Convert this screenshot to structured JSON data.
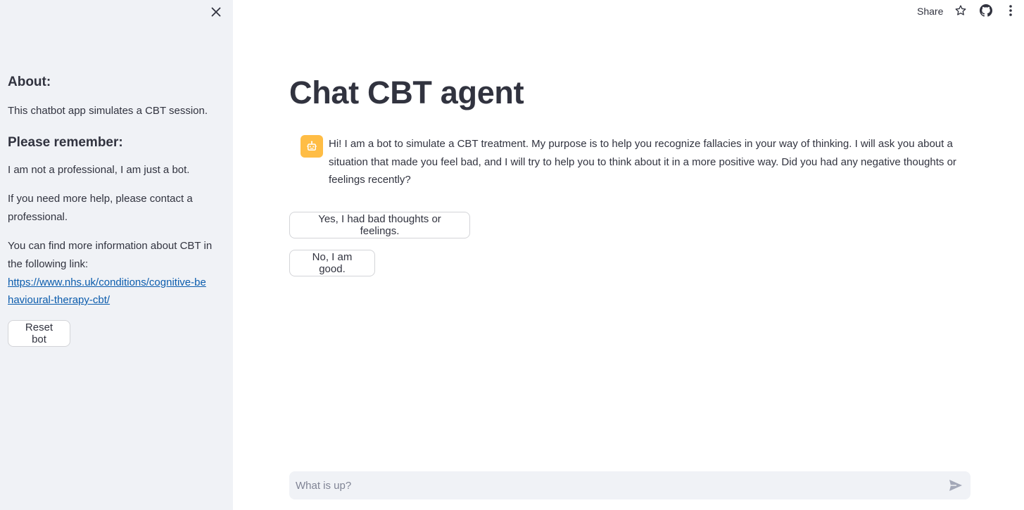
{
  "sidebar": {
    "close_icon": "close-icon",
    "about_heading": "About:",
    "about_text": "This chatbot app simulates a CBT session.",
    "remember_heading": "Please remember:",
    "remember_line1": "I am not a professional, I am just a bot.",
    "remember_line2": "If you need more help, please contact a professional.",
    "remember_line3": "You can find more information about CBT in the following link:",
    "link_text": "https://www.nhs.uk/conditions/cognitive-behavioural-therapy-cbt/",
    "reset_label": "Reset bot"
  },
  "toolbar": {
    "share_label": "Share",
    "star_icon": "star-icon",
    "github_icon": "github-icon",
    "menu_icon": "more-vertical-icon"
  },
  "main": {
    "title": "Chat CBT agent",
    "bot_message": "Hi! I am a bot to simulate a CBT treatment. My purpose is to help you recognize fallacies in your way of thinking. I will ask you about a situation that made you feel bad, and I will try to help you to think about it in a more positive way. Did you had any negative thoughts or feelings recently?",
    "avatar_icon": "bot-icon",
    "avatar_color": "#ffbd45",
    "choices": [
      "Yes, I had bad thoughts or feelings.",
      "No, I am good."
    ]
  },
  "chat_input": {
    "placeholder": "What is up?",
    "send_icon": "send-icon"
  }
}
